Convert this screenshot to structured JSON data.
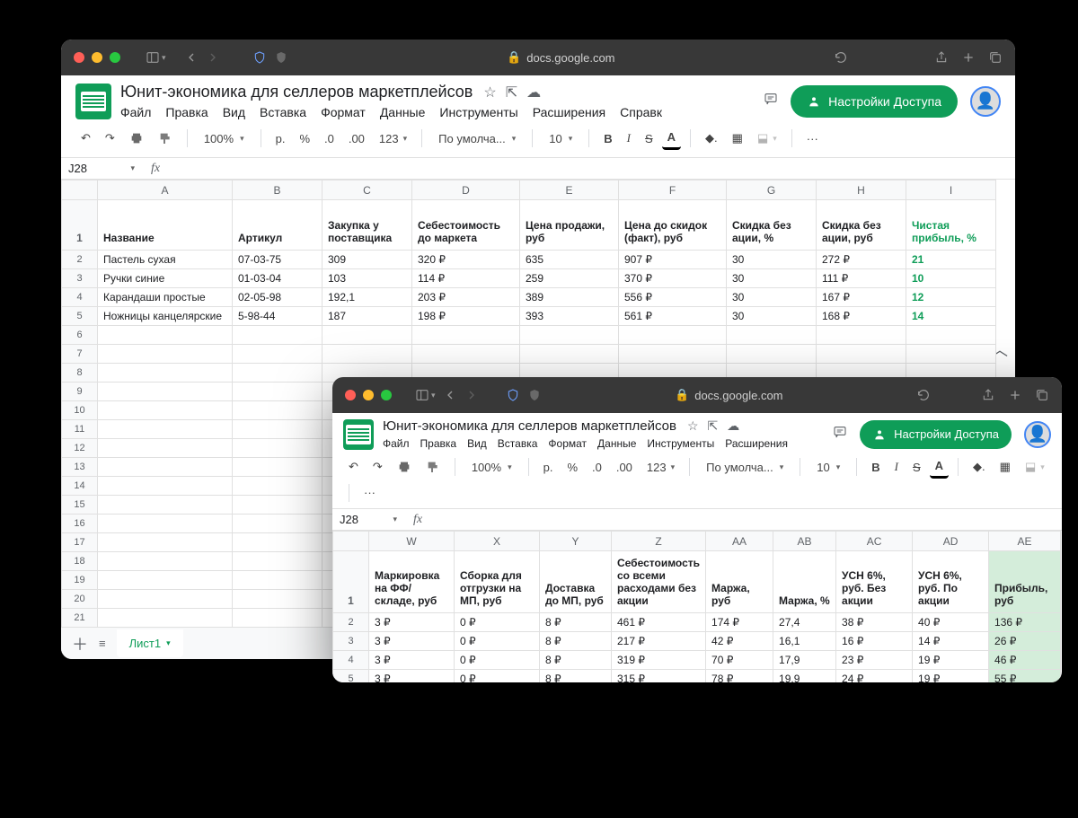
{
  "browser": {
    "url_host": "docs.google.com",
    "lock_label": "🔒"
  },
  "doc": {
    "title": "Юнит-экономика для селлеров маркетплейсов",
    "menus": [
      "Файл",
      "Правка",
      "Вид",
      "Вставка",
      "Формат",
      "Данные",
      "Инструменты",
      "Расширения",
      "Справк"
    ],
    "menus2": [
      "Файл",
      "Правка",
      "Вид",
      "Вставка",
      "Формат",
      "Данные",
      "Инструменты",
      "Расширения"
    ],
    "share_label": "Настройки Доступа",
    "namebox": "J28",
    "sheet_tab": "Лист1",
    "zoom": "100%",
    "currency": "р.",
    "percent": "%",
    "fmt1": ".0",
    "fmt2": ".00",
    "fmt3": "123",
    "font": "По умолча...",
    "font_size": "10",
    "bold": "B",
    "italic": "I",
    "strike": "S",
    "letter_a": "A",
    "more": "···"
  },
  "cols1": [
    "",
    "A",
    "B",
    "C",
    "D",
    "E",
    "F",
    "G",
    "H",
    "I"
  ],
  "headers1": [
    "Название",
    "Артикул",
    "Закупка у поставщика",
    "Себестоимость до маркета",
    "Цена продажи, руб",
    "Цена до скидок (факт), руб",
    "Скидка без ации, %",
    "Скидка без ации, руб",
    "Чистая прибыль, %"
  ],
  "rows1": [
    [
      "Пастель сухая",
      "07-03-75",
      "309",
      "320 ₽",
      "635",
      "907 ₽",
      "30",
      "272 ₽",
      "21"
    ],
    [
      "Ручки синие",
      "01-03-04",
      "103",
      "114 ₽",
      "259",
      "370 ₽",
      "30",
      "111 ₽",
      "10"
    ],
    [
      "Карандаши простые",
      "02-05-98",
      "192,1",
      "203 ₽",
      "389",
      "556 ₽",
      "30",
      "167 ₽",
      "12"
    ],
    [
      "Ножницы канцелярские",
      "5-98-44",
      "187",
      "198 ₽",
      "393",
      "561 ₽",
      "30",
      "168 ₽",
      "14"
    ]
  ],
  "cols2": [
    "",
    "W",
    "X",
    "Y",
    "Z",
    "AA",
    "AB",
    "AC",
    "AD",
    "AE"
  ],
  "headers2": [
    "Маркировка на ФФ/складе, руб",
    "Сборка для отгрузки на МП, руб",
    "Доставка до МП, руб",
    "Себестоимость со всеми расходами без акции",
    "Маржа, руб",
    "Маржа, %",
    "УСН 6%, руб. Без акции",
    "УСН 6%, руб. По акции",
    "Прибыль, руб"
  ],
  "rows2": [
    [
      "3 ₽",
      "0 ₽",
      "8 ₽",
      "461 ₽",
      "174 ₽",
      "27,4",
      "38 ₽",
      "40 ₽",
      "136 ₽"
    ],
    [
      "3 ₽",
      "0 ₽",
      "8 ₽",
      "217 ₽",
      "42 ₽",
      "16,1",
      "16 ₽",
      "14 ₽",
      "26 ₽"
    ],
    [
      "3 ₽",
      "0 ₽",
      "8 ₽",
      "319 ₽",
      "70 ₽",
      "17,9",
      "23 ₽",
      "19 ₽",
      "46 ₽"
    ],
    [
      "3 ₽",
      "0 ₽",
      "8 ₽",
      "315 ₽",
      "78 ₽",
      "19,9",
      "24 ₽",
      "19 ₽",
      "55 ₽"
    ]
  ]
}
